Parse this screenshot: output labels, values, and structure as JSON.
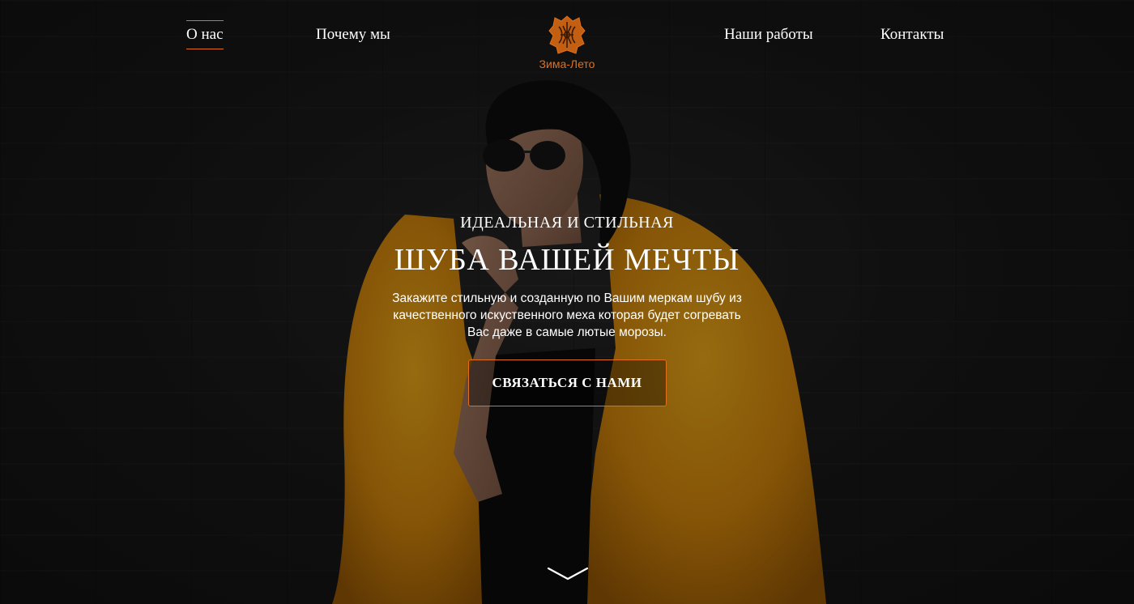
{
  "nav": {
    "items": [
      {
        "label": "О нас",
        "active": true
      },
      {
        "label": "Почему мы",
        "active": false
      },
      {
        "label": "Наши работы",
        "active": false
      },
      {
        "label": "Контакты",
        "active": false
      }
    ]
  },
  "logo": {
    "text": "Зима-Лето",
    "icon": "ornamental-leather-hide-icon"
  },
  "hero": {
    "subtitle": "Идеальная и стильная",
    "title": "Шуба вашей мечты",
    "description": "Закажите стильную и созданную по Вашим меркам шубу из качественного искуственного меха которая будет согревать Вас даже в самые лютые морозы.",
    "cta_label": "Связаться с нами",
    "scroll_icon": "chevron-down-icon"
  },
  "colors": {
    "accent": "#e0701c",
    "text": "#ffffff",
    "fur": "#e89a12",
    "background": "#1a1a1a"
  }
}
